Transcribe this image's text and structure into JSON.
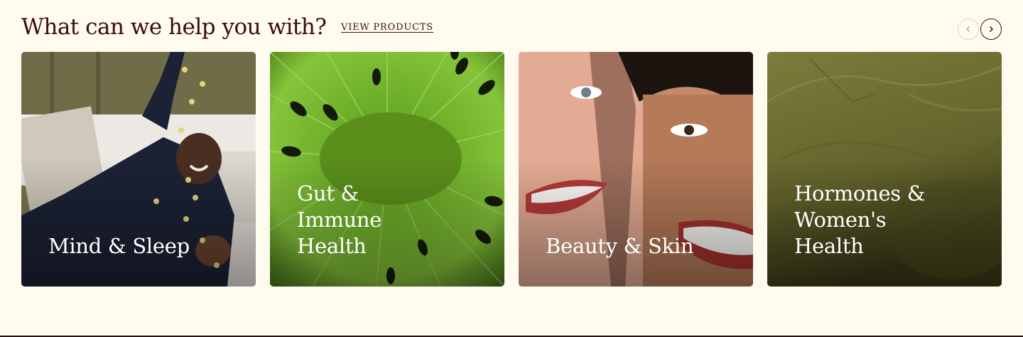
{
  "section": {
    "title": "What can we help you with?",
    "view_link": "VIEW PRODUCTS"
  },
  "carousel": {
    "prev_icon": "chevron-left-icon",
    "next_icon": "chevron-right-icon",
    "prev_state": "disabled",
    "next_state": "enabled"
  },
  "categories": [
    {
      "label": "Mind & Sleep",
      "image": "woman-in-bed-photo"
    },
    {
      "label": "Gut &\nImmune\nHealth",
      "image": "kiwi-closeup-photo"
    },
    {
      "label": "Beauty & Skin",
      "image": "smiling-women-photo"
    },
    {
      "label": "Hormones &\nWomen's\nHealth",
      "image": "green-powder-photo"
    }
  ],
  "colors": {
    "background": "#fffbef",
    "text": "#3a0d0d",
    "card_text": "#ffffff"
  }
}
